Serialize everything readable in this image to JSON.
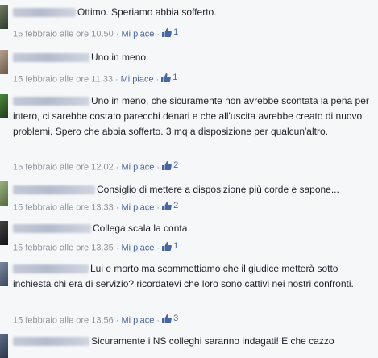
{
  "comments": [
    {
      "text": "Ottimo. Speriamo abbia sofferto.",
      "time": "15 febbraio alle ore 10.50",
      "like_label": "Mi piace",
      "likes": "1"
    },
    {
      "text": "Uno in meno",
      "time": "15 febbraio alle ore 11.33",
      "like_label": "Mi piace",
      "likes": "1"
    },
    {
      "text": "Uno in meno, che sicuramente non avrebbe scontata la pena per intero, ci sarebbe costato parecchi denari e che all'uscita avrebbe creato di nuovo problemi. Spero che abbia sofferto. 3 mq a disposizione per qualcun'altro.",
      "time": "15 febbraio alle ore 12.02",
      "like_label": "Mi piace",
      "likes": "2"
    },
    {
      "text": "Consiglio di mettere a disposizione più corde e sapone...",
      "time": "15 febbraio alle ore 13.33",
      "like_label": "Mi piace",
      "likes": "2"
    },
    {
      "text": "Collega scala la conta",
      "time": "15 febbraio alle ore 13.35",
      "like_label": "Mi piace",
      "likes": "1"
    },
    {
      "text": "Lui e morto ma scommettiamo che il giudice metterà sotto inchiesta chi era di servizio? ricordatevi che loro sono cattivi nei nostri confronti.",
      "time": "15 febbraio alle ore 13.56",
      "like_label": "Mi piace",
      "likes": "3"
    },
    {
      "text": "Sicuramente i NS colleghi saranno indagati! E che cazzo"
    }
  ],
  "icons": {
    "like": "thumbs-up-icon"
  },
  "colors": {
    "link": "#4b67a1",
    "meta": "#90949c",
    "background": "#f6f7f9"
  }
}
